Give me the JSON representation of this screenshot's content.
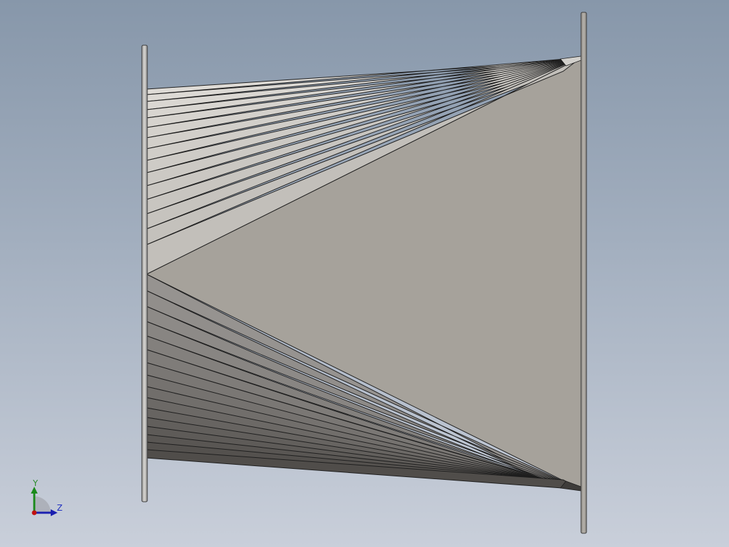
{
  "viewport": {
    "background_top": "#8797aa",
    "background_bottom": "#c9cfda"
  },
  "model": {
    "description_icon": "transition-duct-part",
    "face_color": "#a8a39c",
    "edge_color": "#1e1e1e"
  },
  "triad": {
    "y_label": "Y",
    "z_label": "Z",
    "y_color": "#1a8a1a",
    "z_color": "#1a1fb0",
    "origin_color": "#c01010"
  }
}
